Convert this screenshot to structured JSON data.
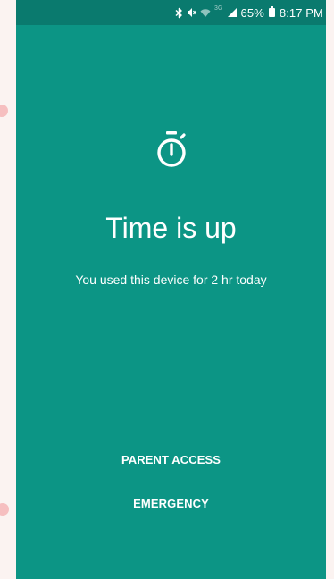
{
  "status_bar": {
    "icons": [
      "bluetooth-icon",
      "mute-icon",
      "wifi-icon",
      "signal-icon",
      "battery-icon"
    ],
    "network_type": "3G",
    "battery_percent": "65%",
    "time": "8:17 PM"
  },
  "screen": {
    "icon": "timer-icon",
    "title": "Time is up",
    "message": "You used this device for 2 hr today",
    "parent_access_label": "PARENT ACCESS",
    "emergency_label": "EMERGENCY"
  },
  "colors": {
    "background": "#0c9585",
    "status_bar": "#0a7a6e",
    "text": "#ffffff"
  }
}
